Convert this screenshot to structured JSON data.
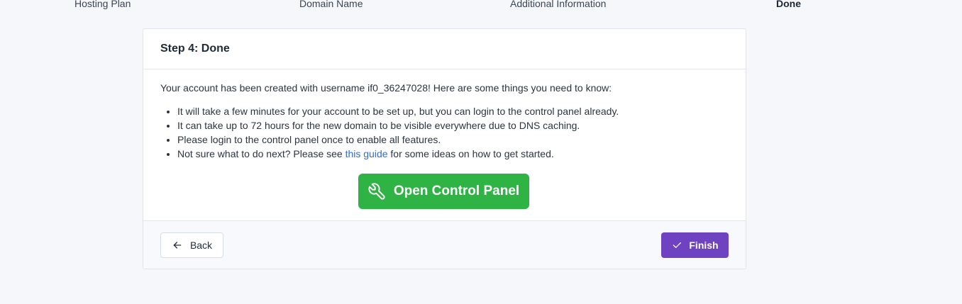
{
  "steps": [
    {
      "label": "Hosting Plan",
      "active": false
    },
    {
      "label": "Domain Name",
      "active": false
    },
    {
      "label": "Additional Information",
      "active": false
    },
    {
      "label": "Done",
      "active": true
    }
  ],
  "card": {
    "title": "Step 4: Done",
    "intro_prefix": "Your account has been created with username ",
    "username": "if0_36247028",
    "intro_suffix": "! Here are some things you need to know:",
    "bullets": [
      "It will take a few minutes for your account to be set up, but you can login to the control panel already.",
      "It can take up to 72 hours for the new domain to be visible everywhere due to DNS caching.",
      "Please login to the control panel once to enable all features."
    ],
    "guide_bullet": {
      "prefix": "Not sure what to do next? Please see ",
      "link_text": "this guide",
      "suffix": " for some ideas on how to get started."
    },
    "control_panel_button": {
      "label": "Open Control Panel",
      "icon": "wrench-icon",
      "color": "#2fb344"
    }
  },
  "footer": {
    "back_label": "Back",
    "back_icon": "arrow-left-icon",
    "finish_label": "Finish",
    "finish_icon": "check-icon",
    "finish_color": "#6f42c1"
  }
}
